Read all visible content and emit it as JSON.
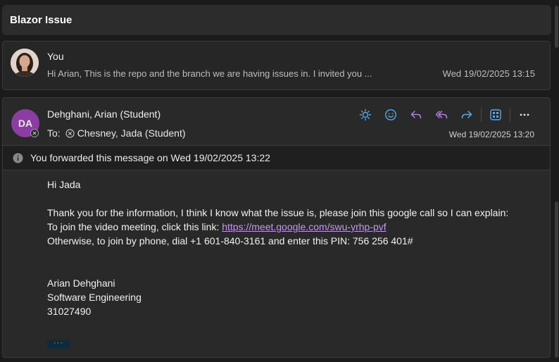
{
  "subject": "Blazor Issue",
  "message1": {
    "sender": "You",
    "preview": "Hi Arian, This is the repo and the branch we are having issues in. I invited you ...",
    "date": "Wed 19/02/2025 13:15"
  },
  "message2": {
    "avatar_initials": "DA",
    "avatar_color": "#8a3ea1",
    "from": "Dehghani, Arian (Student)",
    "to_label": "To:",
    "to_name": "Chesney, Jada (Student)",
    "date": "Wed 19/02/2025 13:20",
    "toolbar_icons": [
      "sun-icon",
      "emoji-icon",
      "reply-icon",
      "reply-all-icon",
      "forward-icon",
      "apps-icon",
      "more-icon"
    ],
    "forward_notice": "You forwarded this message on Wed 19/02/2025 13:22",
    "body": {
      "greeting": "Hi Jada",
      "line1": "Thank you for the information, I think I know what the issue is, please join this google call so I can explain:",
      "line2_prefix": "To join the video meeting, click this link: ",
      "link": "https://meet.google.com/swu-yrhp-pvf",
      "line3": "Otherwise, to join by phone, dial +1 601-840-3161 and enter this PIN: 756 256 401#",
      "sig_name": "Arian Dehghani",
      "sig_dept": "Software Engineering",
      "sig_id": "31027490"
    },
    "show_more": "···"
  },
  "colors": {
    "accent_blue": "#5aa7e6",
    "accent_purple": "#b07ee0",
    "link": "#c39ae8"
  }
}
